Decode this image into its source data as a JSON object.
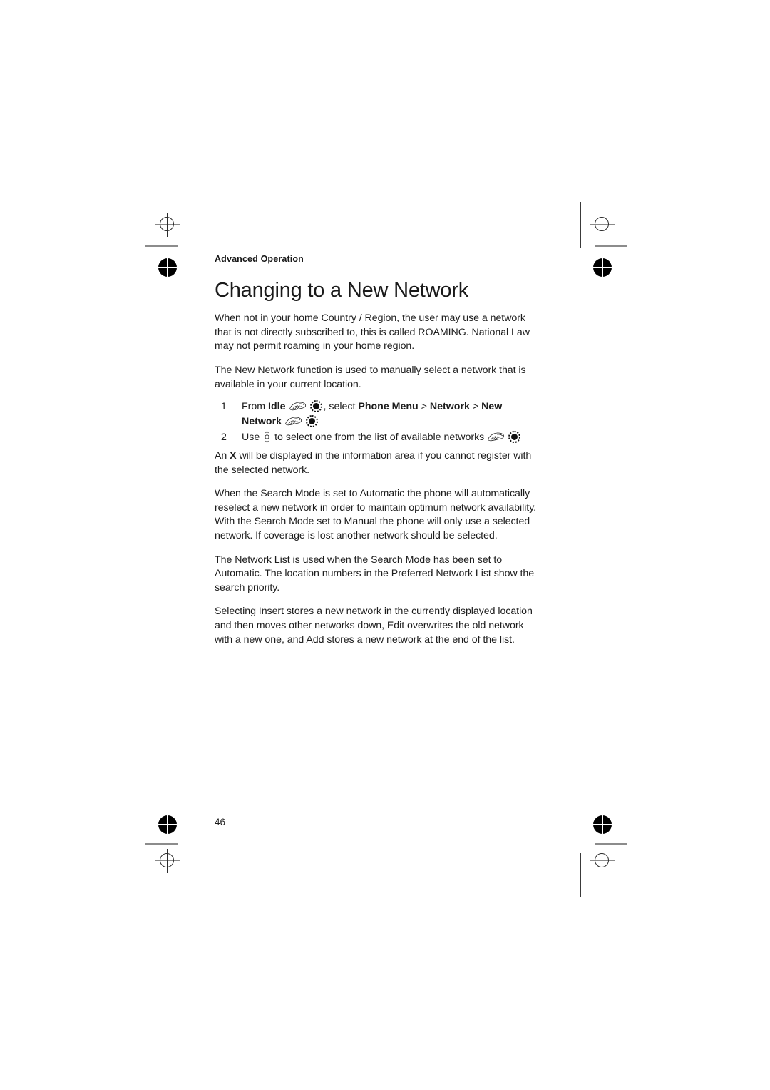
{
  "page": {
    "running_head": "Advanced Operation",
    "title": "Changing to a New Network",
    "folio": "46"
  },
  "intro": {
    "paragraph_1_a": "When not in your home Country / Region, the user may use a network that is not directly subscribed to, this is called ROAMING. National Law may not permit roaming in your home region.",
    "paragraph_2": "The New Network function is used to manually select a network that is available in your current location."
  },
  "steps": [
    {
      "number": "1",
      "lead": "From ",
      "bold_1": "Idle",
      "mid": ", select ",
      "bold_2": "Phone Menu",
      "sep_1": " > ",
      "bold_3": "Network",
      "sep_2": " > ",
      "bold_4": "New Network"
    },
    {
      "number": "2",
      "lead": "Use ",
      "mid": " to select one from the list of available networks"
    }
  ],
  "notes": {
    "paragraph_3_a": "An ",
    "paragraph_3_bold": "X",
    "paragraph_3_b": " will be displayed in the information area if you cannot register with the selected network.",
    "paragraph_4": "When the Search Mode is set to Automatic the phone will automatically reselect a new network in order to maintain optimum network availability. With the Search Mode set to Manual the phone will only use a selected network. If coverage is lost another network should be selected.",
    "paragraph_5": "The Network List is used when the Search Mode has been set to Automatic. The location numbers in the Preferred Network List show the search priority.",
    "paragraph_6": "Selecting Insert stores a new network in the currently displayed location and then moves other networks down, Edit overwrites the old network with a new one, and Add stores a new network at the end of the list."
  },
  "icons": {
    "hand": "pointing-hand-icon",
    "select_key": "select-key-icon",
    "nav_key": "up-down-navigation-key-icon"
  },
  "colors": {
    "text": "#1c1c1c",
    "rule": "#9b9b9b",
    "mark": "#2b2b2b",
    "paper": "#ffffff"
  }
}
